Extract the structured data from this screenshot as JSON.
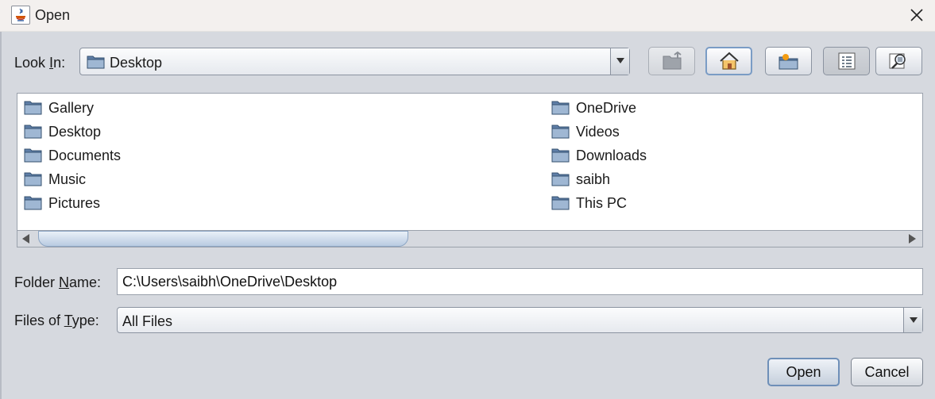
{
  "window": {
    "title": "Open"
  },
  "look_in": {
    "label_pre": "Look ",
    "label_mnemonic": "I",
    "label_post": "n:",
    "value": "Desktop"
  },
  "toolbar": [
    "up-one-level",
    "home",
    "new-folder",
    "list-view",
    "details-view"
  ],
  "files": {
    "left": [
      "Gallery",
      "Desktop",
      "Documents",
      "Music",
      "Pictures"
    ],
    "right": [
      "OneDrive",
      "Videos",
      "Downloads",
      "saibh",
      "This PC"
    ]
  },
  "folder_name": {
    "label_pre": "Folder ",
    "label_mnemonic": "N",
    "label_post": "ame:",
    "value": "C:\\Users\\saibh\\OneDrive\\Desktop"
  },
  "files_of_type": {
    "label_pre": "Files of ",
    "label_mnemonic": "T",
    "label_post": "ype:",
    "value": "All Files"
  },
  "buttons": {
    "open": "Open",
    "cancel": "Cancel"
  }
}
